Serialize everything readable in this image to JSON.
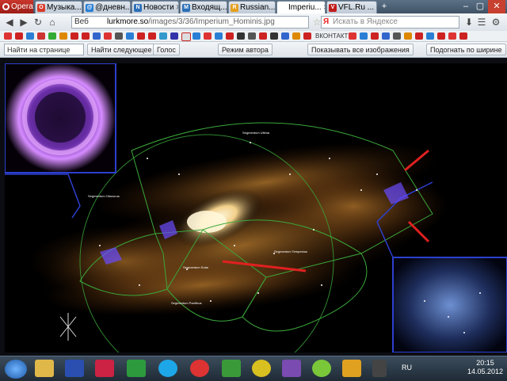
{
  "browser": {
    "menu_label": "Opera",
    "tabs": [
      {
        "label": "Музыка...",
        "color": "#d93b2b",
        "glyph": "O"
      },
      {
        "label": "@дневн...",
        "color": "#2a7fd4",
        "glyph": "@"
      },
      {
        "label": "Новости",
        "color": "#2b6fb8",
        "glyph": "N"
      },
      {
        "label": "Входящ...",
        "color": "#2b6fb8",
        "glyph": "M"
      },
      {
        "label": "Russian...",
        "color": "#e6a01d",
        "glyph": "R"
      },
      {
        "label": "Imperiu...",
        "color": "#c21b1b",
        "glyph": "L"
      },
      {
        "label": "VFL.Ru ...",
        "color": "#c21b1b",
        "glyph": "V"
      }
    ],
    "url_scheme_label": "Веб",
    "url_domain": "lurkmore.so",
    "url_path": "/images/3/36/Imperium_Hominis.jpg",
    "search_placeholder": "Искать в Яндексе",
    "search_engine_glyph": "Я",
    "speeddial_label_vk": "ВКОНТАКТЕ"
  },
  "findbar": {
    "find_placeholder": "Найти на странице",
    "find_next": "Найти следующее",
    "voice": "Голос",
    "author_mode": "Режим автора",
    "show_all_images": "Показывать все изображения",
    "fit_width": "Подогнать по ширине"
  },
  "map": {
    "labels": {
      "seg_obscurus": "Segmentum Obscurus",
      "seg_solar": "Segmentum Solar",
      "seg_tempestus": "Segmentum Tempestus",
      "seg_pacificus": "Segmentum Pacificus",
      "seg_ultima": "Segmentum Ultima"
    }
  },
  "taskbar": {
    "lang": "RU",
    "time": "20:15",
    "date": "14.05.2012"
  },
  "colors": {
    "accent": "#d93b2b",
    "frame_blue": "#2c3fcf",
    "segment_green": "#3aa83a"
  }
}
